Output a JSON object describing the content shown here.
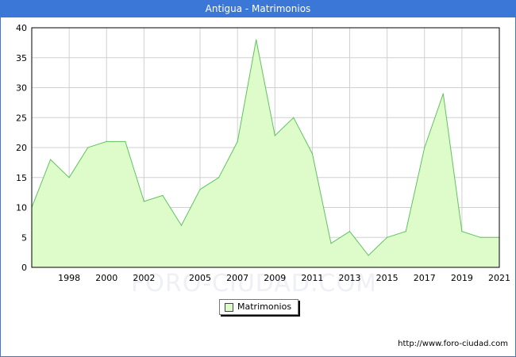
{
  "header": {
    "title": "Antigua - Matrimonios"
  },
  "watermark": "FORO-CIUDAD.COM",
  "footer": {
    "url": "http://www.foro-ciudad.com"
  },
  "colors": {
    "titlebar": "#3b77d6",
    "area_fill": "#ddfcc9",
    "area_line": "#5fc35f",
    "grid": "#d0d0d0"
  },
  "chart_data": {
    "type": "area",
    "title": "Antigua - Matrimonios",
    "xlabel": "",
    "ylabel": "",
    "ylim": [
      0,
      40
    ],
    "yticks": [
      0,
      5,
      10,
      15,
      20,
      25,
      30,
      35,
      40
    ],
    "xlim": [
      1996,
      2021
    ],
    "xticks": [
      1998,
      2000,
      2002,
      2005,
      2007,
      2009,
      2011,
      2013,
      2015,
      2017,
      2019,
      2021
    ],
    "grid": true,
    "legend": "bottom-center",
    "series": [
      {
        "name": "Matrimonios",
        "x": [
          1996,
          1997,
          1998,
          1999,
          2000,
          2001,
          2002,
          2003,
          2004,
          2005,
          2006,
          2007,
          2008,
          2009,
          2010,
          2011,
          2012,
          2013,
          2014,
          2015,
          2016,
          2017,
          2018,
          2019,
          2020,
          2021
        ],
        "values": [
          10,
          18,
          15,
          20,
          21,
          21,
          11,
          12,
          7,
          13,
          15,
          21,
          38,
          22,
          25,
          19,
          4,
          6,
          2,
          5,
          6,
          20,
          29,
          6,
          5,
          5
        ]
      }
    ]
  }
}
